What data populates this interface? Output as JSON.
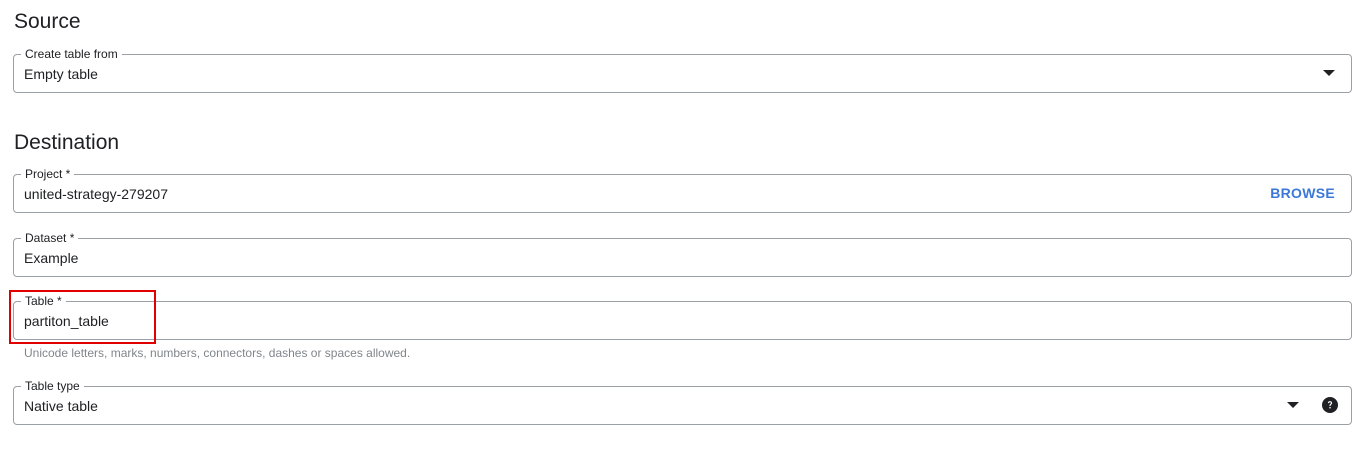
{
  "source": {
    "heading": "Source",
    "create_table_from": {
      "label": "Create table from",
      "value": "Empty table"
    }
  },
  "destination": {
    "heading": "Destination",
    "project": {
      "label": "Project *",
      "value": "united-strategy-279207",
      "browse_label": "BROWSE"
    },
    "dataset": {
      "label": "Dataset *",
      "value": "Example"
    },
    "table": {
      "label": "Table *",
      "value": "partiton_table",
      "hint": "Unicode letters, marks, numbers, connectors, dashes or spaces allowed."
    },
    "table_type": {
      "label": "Table type",
      "value": "Native table"
    }
  },
  "icons": {
    "dropdown": "chevron-down-icon",
    "help": "help-icon"
  },
  "colors": {
    "accent": "#3c78d8",
    "highlight": "#e00000",
    "border": "#9aa0a6",
    "hint": "#80868b"
  }
}
